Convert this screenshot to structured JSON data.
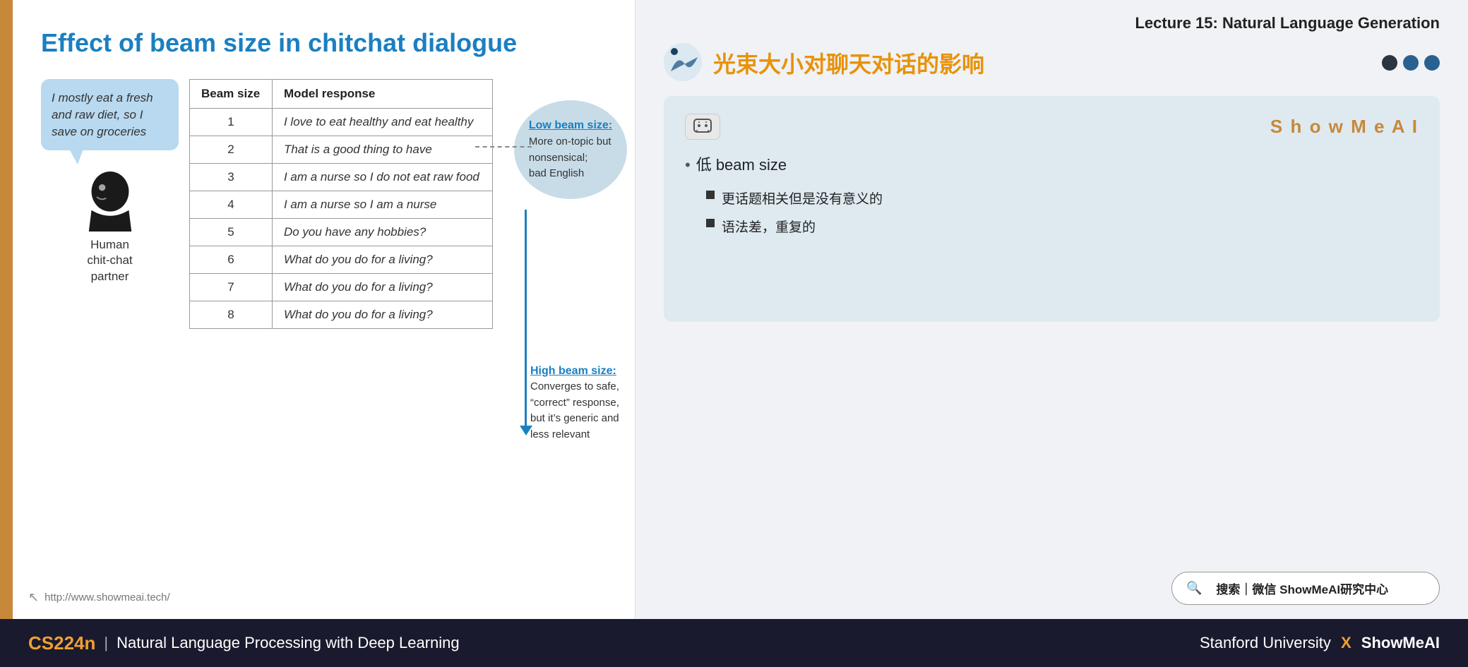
{
  "lecture": {
    "title": "Lecture 15: Natural Language Generation"
  },
  "left_panel": {
    "slide_title": "Effect of beam size in chitchat dialogue",
    "speech_bubble": "I mostly eat a fresh and raw diet, so I save on groceries",
    "human_label_line1": "Human",
    "human_label_line2": "chit-chat",
    "human_label_line3": "partner",
    "table": {
      "col1_header": "Beam size",
      "col2_header": "Model response",
      "rows": [
        {
          "beam": "1",
          "response": "I love to eat healthy and eat healthy"
        },
        {
          "beam": "2",
          "response": "That is a good thing to have"
        },
        {
          "beam": "3",
          "response": "I am a nurse so I do not eat raw food"
        },
        {
          "beam": "4",
          "response": "I am a nurse so I am a nurse"
        },
        {
          "beam": "5",
          "response": "Do you have any hobbies?"
        },
        {
          "beam": "6",
          "response": "What do you do for a living?"
        },
        {
          "beam": "7",
          "response": "What do you do for a living?"
        },
        {
          "beam": "8",
          "response": "What do you do for a living?"
        }
      ]
    },
    "low_beam": {
      "title": "Low beam size:",
      "line1": "More on-topic but",
      "line2": "nonsensical;",
      "line3": "bad English"
    },
    "high_beam": {
      "title": "High beam size:",
      "line1": "Converges to safe,",
      "line2": "“correct” response,",
      "line3": "but it’s generic and",
      "line4": "less relevant"
    },
    "footer_url": "http://www.showmeai.tech/"
  },
  "right_panel": {
    "chinese_title": "光束大小对聊天对话的影响",
    "card": {
      "brand": "S h o w M e A I",
      "ai_badge": "🤖",
      "main_point": "低 beam size",
      "sub1": "更话题相关但是没有意义的",
      "sub2": "语法差，重复的"
    },
    "search": {
      "icon": "🔍",
      "text": "搜索｜微信 ShowMeAI研究中心"
    }
  },
  "bottom_bar": {
    "cs_label": "CS224n",
    "separator": "|",
    "course_name": "Natural Language Processing with Deep Learning",
    "right_text_pre": "Stanford University",
    "x_sep": "X",
    "right_text_post": "ShowMeAI"
  },
  "dots": [
    {
      "label": "dot1"
    },
    {
      "label": "dot2"
    },
    {
      "label": "dot3"
    }
  ]
}
